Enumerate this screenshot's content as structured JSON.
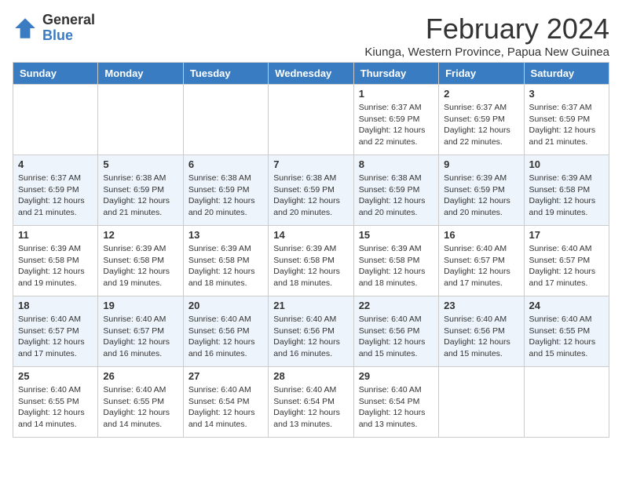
{
  "logo": {
    "general": "General",
    "blue": "Blue"
  },
  "title": "February 2024",
  "subtitle": "Kiunga, Western Province, Papua New Guinea",
  "days_of_week": [
    "Sunday",
    "Monday",
    "Tuesday",
    "Wednesday",
    "Thursday",
    "Friday",
    "Saturday"
  ],
  "weeks": [
    [
      {
        "day": "",
        "info": ""
      },
      {
        "day": "",
        "info": ""
      },
      {
        "day": "",
        "info": ""
      },
      {
        "day": "",
        "info": ""
      },
      {
        "day": "1",
        "info": "Sunrise: 6:37 AM\nSunset: 6:59 PM\nDaylight: 12 hours and 22 minutes."
      },
      {
        "day": "2",
        "info": "Sunrise: 6:37 AM\nSunset: 6:59 PM\nDaylight: 12 hours and 22 minutes."
      },
      {
        "day": "3",
        "info": "Sunrise: 6:37 AM\nSunset: 6:59 PM\nDaylight: 12 hours and 21 minutes."
      }
    ],
    [
      {
        "day": "4",
        "info": "Sunrise: 6:37 AM\nSunset: 6:59 PM\nDaylight: 12 hours and 21 minutes."
      },
      {
        "day": "5",
        "info": "Sunrise: 6:38 AM\nSunset: 6:59 PM\nDaylight: 12 hours and 21 minutes."
      },
      {
        "day": "6",
        "info": "Sunrise: 6:38 AM\nSunset: 6:59 PM\nDaylight: 12 hours and 20 minutes."
      },
      {
        "day": "7",
        "info": "Sunrise: 6:38 AM\nSunset: 6:59 PM\nDaylight: 12 hours and 20 minutes."
      },
      {
        "day": "8",
        "info": "Sunrise: 6:38 AM\nSunset: 6:59 PM\nDaylight: 12 hours and 20 minutes."
      },
      {
        "day": "9",
        "info": "Sunrise: 6:39 AM\nSunset: 6:59 PM\nDaylight: 12 hours and 20 minutes."
      },
      {
        "day": "10",
        "info": "Sunrise: 6:39 AM\nSunset: 6:58 PM\nDaylight: 12 hours and 19 minutes."
      }
    ],
    [
      {
        "day": "11",
        "info": "Sunrise: 6:39 AM\nSunset: 6:58 PM\nDaylight: 12 hours and 19 minutes."
      },
      {
        "day": "12",
        "info": "Sunrise: 6:39 AM\nSunset: 6:58 PM\nDaylight: 12 hours and 19 minutes."
      },
      {
        "day": "13",
        "info": "Sunrise: 6:39 AM\nSunset: 6:58 PM\nDaylight: 12 hours and 18 minutes."
      },
      {
        "day": "14",
        "info": "Sunrise: 6:39 AM\nSunset: 6:58 PM\nDaylight: 12 hours and 18 minutes."
      },
      {
        "day": "15",
        "info": "Sunrise: 6:39 AM\nSunset: 6:58 PM\nDaylight: 12 hours and 18 minutes."
      },
      {
        "day": "16",
        "info": "Sunrise: 6:40 AM\nSunset: 6:57 PM\nDaylight: 12 hours and 17 minutes."
      },
      {
        "day": "17",
        "info": "Sunrise: 6:40 AM\nSunset: 6:57 PM\nDaylight: 12 hours and 17 minutes."
      }
    ],
    [
      {
        "day": "18",
        "info": "Sunrise: 6:40 AM\nSunset: 6:57 PM\nDaylight: 12 hours and 17 minutes."
      },
      {
        "day": "19",
        "info": "Sunrise: 6:40 AM\nSunset: 6:57 PM\nDaylight: 12 hours and 16 minutes."
      },
      {
        "day": "20",
        "info": "Sunrise: 6:40 AM\nSunset: 6:56 PM\nDaylight: 12 hours and 16 minutes."
      },
      {
        "day": "21",
        "info": "Sunrise: 6:40 AM\nSunset: 6:56 PM\nDaylight: 12 hours and 16 minutes."
      },
      {
        "day": "22",
        "info": "Sunrise: 6:40 AM\nSunset: 6:56 PM\nDaylight: 12 hours and 15 minutes."
      },
      {
        "day": "23",
        "info": "Sunrise: 6:40 AM\nSunset: 6:56 PM\nDaylight: 12 hours and 15 minutes."
      },
      {
        "day": "24",
        "info": "Sunrise: 6:40 AM\nSunset: 6:55 PM\nDaylight: 12 hours and 15 minutes."
      }
    ],
    [
      {
        "day": "25",
        "info": "Sunrise: 6:40 AM\nSunset: 6:55 PM\nDaylight: 12 hours and 14 minutes."
      },
      {
        "day": "26",
        "info": "Sunrise: 6:40 AM\nSunset: 6:55 PM\nDaylight: 12 hours and 14 minutes."
      },
      {
        "day": "27",
        "info": "Sunrise: 6:40 AM\nSunset: 6:54 PM\nDaylight: 12 hours and 14 minutes."
      },
      {
        "day": "28",
        "info": "Sunrise: 6:40 AM\nSunset: 6:54 PM\nDaylight: 12 hours and 13 minutes."
      },
      {
        "day": "29",
        "info": "Sunrise: 6:40 AM\nSunset: 6:54 PM\nDaylight: 12 hours and 13 minutes."
      },
      {
        "day": "",
        "info": ""
      },
      {
        "day": "",
        "info": ""
      }
    ]
  ]
}
